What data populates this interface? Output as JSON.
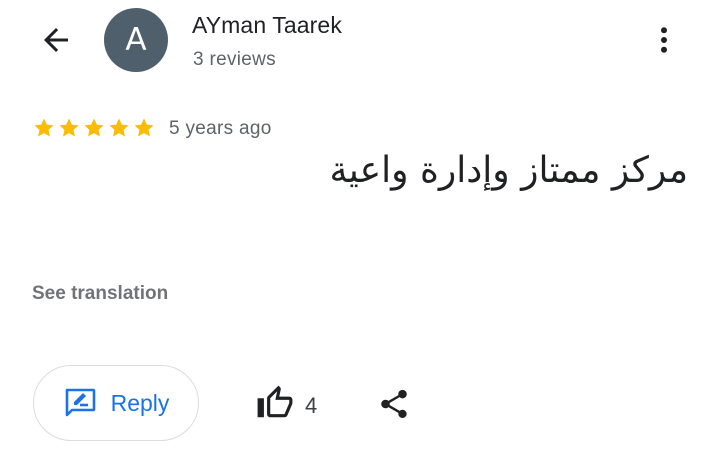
{
  "header": {
    "avatar_letter": "A",
    "avatar_color": "#4f5f6b",
    "reviewer_name": "AYman Taarek",
    "review_count": "3 reviews",
    "back_icon": "arrow-back-icon",
    "more_icon": "more-vert-icon"
  },
  "review": {
    "rating": 5,
    "max_rating": 5,
    "star_color": "#fbbc04",
    "time": "5 years ago",
    "text": "مركز ممتاز وإدارة واعية",
    "see_translation": "See translation"
  },
  "actions": {
    "reply_label": "Reply",
    "reply_icon": "edit-reply-icon",
    "like_icon": "thumb-up-icon",
    "like_count": "4",
    "share_icon": "share-icon",
    "accent_color": "#1a73e8"
  }
}
